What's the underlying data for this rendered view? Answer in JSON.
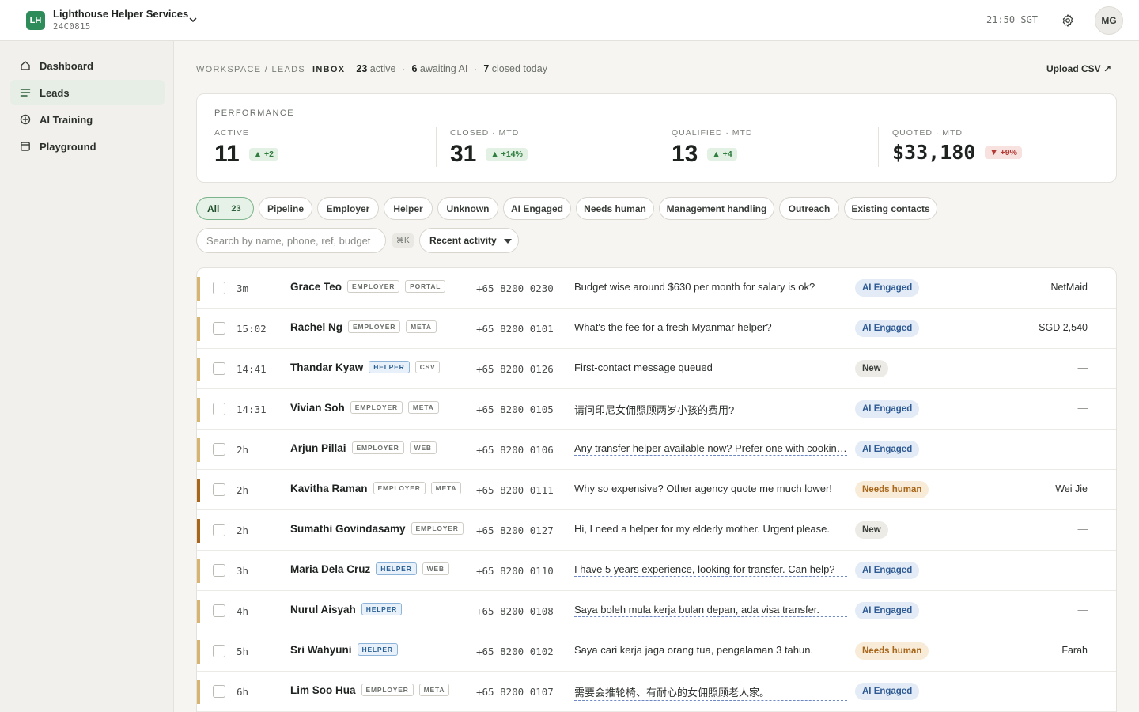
{
  "app": {
    "logo_initials": "LH",
    "name": "Lighthouse Helper Services",
    "code": "24C0815",
    "clock": "21:50 SGT",
    "avatar_initials": "MG"
  },
  "sidebar": {
    "items": [
      {
        "label": "Dashboard",
        "icon": "home-icon",
        "active": false
      },
      {
        "label": "Leads",
        "icon": "list-icon",
        "active": true
      },
      {
        "label": "AI Training",
        "icon": "plus-circle-icon",
        "active": false
      },
      {
        "label": "Playground",
        "icon": "window-icon",
        "active": false
      }
    ]
  },
  "header": {
    "crumb_path": "WORKSPACE / LEADS",
    "crumb_current": "INBOX",
    "stat_active_n": "23",
    "stat_active_label": "active",
    "stat_await_n": "6",
    "stat_await_label": "awaiting AI",
    "stat_closed_n": "7",
    "stat_closed_label": "closed today",
    "upload_label": "Upload CSV ↗"
  },
  "performance": {
    "title": "PERFORMANCE",
    "kpis": [
      {
        "label": "ACTIVE",
        "value": "11",
        "delta": "▲ +2",
        "trend": "up"
      },
      {
        "label": "CLOSED · MTD",
        "value": "31",
        "delta": "▲ +14%",
        "trend": "up"
      },
      {
        "label": "QUALIFIED · MTD",
        "value": "13",
        "delta": "▲ +4",
        "trend": "up"
      },
      {
        "label": "QUOTED · MTD",
        "value": "$33,180",
        "delta": "▼ +9%",
        "trend": "down"
      }
    ]
  },
  "filters": {
    "all_label": "All",
    "all_count": "23",
    "chips": [
      "Pipeline",
      "Employer",
      "Helper",
      "Unknown",
      "AI Engaged",
      "Needs human",
      "Management handling",
      "Outreach",
      "Existing contacts"
    ]
  },
  "search": {
    "placeholder": "Search by name, phone, ref, budget",
    "shortcut": "⌘K",
    "sort_label": "Recent activity"
  },
  "leads": [
    {
      "time": "3m",
      "name": "Grace Teo",
      "tags": [
        "EMPLOYER",
        "PORTAL"
      ],
      "phone": "+65 8200 0230",
      "message": "Budget wise around $630 per month for salary is ok?",
      "underlined": false,
      "status": "AI Engaged",
      "status_kind": "ai",
      "owner": "NetMaid",
      "bar_color": "#d9b46e"
    },
    {
      "time": "15:02",
      "name": "Rachel Ng",
      "tags": [
        "EMPLOYER",
        "META"
      ],
      "phone": "+65 8200 0101",
      "message": "What's the fee for a fresh Myanmar helper?",
      "underlined": false,
      "status": "AI Engaged",
      "status_kind": "ai",
      "owner": "SGD 2,540",
      "bar_color": "#d9b46e"
    },
    {
      "time": "14:41",
      "name": "Thandar Kyaw",
      "tags": [
        "HELPER",
        "CSV"
      ],
      "phone": "+65 8200 0126",
      "message": "First-contact message queued",
      "underlined": false,
      "status": "New",
      "status_kind": "new",
      "owner": "—",
      "bar_color": "#d9b46e"
    },
    {
      "time": "14:31",
      "name": "Vivian Soh",
      "tags": [
        "EMPLOYER",
        "META"
      ],
      "phone": "+65 8200 0105",
      "message": "请问印尼女佣照顾两岁小孩的费用?",
      "underlined": false,
      "status": "AI Engaged",
      "status_kind": "ai",
      "owner": "—",
      "bar_color": "#d9b46e"
    },
    {
      "time": "2h",
      "name": "Arjun Pillai",
      "tags": [
        "EMPLOYER",
        "WEB"
      ],
      "phone": "+65 8200 0106",
      "message": "Any transfer helper available now? Prefer one with cooking experience",
      "underlined": true,
      "status": "AI Engaged",
      "status_kind": "ai",
      "owner": "—",
      "bar_color": "#d9b46e"
    },
    {
      "time": "2h",
      "name": "Kavitha Raman",
      "tags": [
        "EMPLOYER",
        "META"
      ],
      "phone": "+65 8200 0111",
      "message": "Why so expensive? Other agency quote me much lower!",
      "underlined": false,
      "status": "Needs human",
      "status_kind": "human",
      "owner": "Wei Jie",
      "bar_color": "#a8661b"
    },
    {
      "time": "2h",
      "name": "Sumathi Govindasamy",
      "tags": [
        "EMPLOYER"
      ],
      "phone": "+65 8200 0127",
      "message": "Hi, I need a helper for my elderly mother. Urgent please.",
      "underlined": false,
      "status": "New",
      "status_kind": "new",
      "owner": "—",
      "bar_color": "#a8661b"
    },
    {
      "time": "3h",
      "name": "Maria Dela Cruz",
      "tags": [
        "HELPER",
        "WEB"
      ],
      "phone": "+65 8200 0110",
      "message": "I have 5 years experience, looking for transfer. Can help?",
      "underlined": true,
      "status": "AI Engaged",
      "status_kind": "ai",
      "owner": "—",
      "bar_color": "#d9b46e"
    },
    {
      "time": "4h",
      "name": "Nurul Aisyah",
      "tags": [
        "HELPER"
      ],
      "phone": "+65 8200 0108",
      "message": "Saya boleh mula kerja bulan depan, ada visa transfer.",
      "underlined": true,
      "status": "AI Engaged",
      "status_kind": "ai",
      "owner": "—",
      "bar_color": "#d9b46e"
    },
    {
      "time": "5h",
      "name": "Sri Wahyuni",
      "tags": [
        "HELPER"
      ],
      "phone": "+65 8200 0102",
      "message": "Saya cari kerja jaga orang tua, pengalaman 3 tahun.",
      "underlined": true,
      "status": "Needs human",
      "status_kind": "human",
      "owner": "Farah",
      "bar_color": "#d9b46e"
    },
    {
      "time": "6h",
      "name": "Lim Soo Hua",
      "tags": [
        "EMPLOYER",
        "META"
      ],
      "phone": "+65 8200 0107",
      "message": "需要会推轮椅、有耐心的女佣照顾老人家。",
      "underlined": true,
      "status": "AI Engaged",
      "status_kind": "ai",
      "owner": "—",
      "bar_color": "#d9b46e"
    }
  ]
}
